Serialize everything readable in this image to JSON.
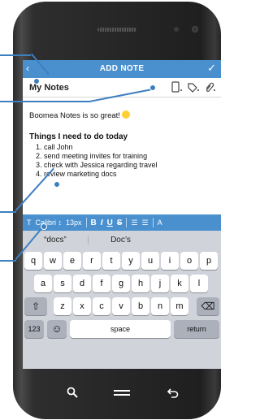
{
  "appbar": {
    "title": "ADD NOTE",
    "back_icon": "chevron-left-icon",
    "save_icon": "checkmark-icon"
  },
  "note": {
    "title": "My Notes",
    "intro": "Boomea Notes is so great!",
    "heading": "Things I need to do today",
    "items": [
      "call John",
      "send meeting invites for training",
      "check with Jessica regarding travel",
      "review marketing docs"
    ]
  },
  "format_bar": {
    "text_icon": "T",
    "font": "Calibri ↕",
    "size": "13px",
    "bold": "B",
    "italic": "I",
    "underline": "U",
    "strike": "S",
    "bullets_icon": "☰",
    "numbered_icon": "☰",
    "more": "A"
  },
  "keyboard": {
    "suggestions": [
      "“docs”",
      "Doc’s",
      ""
    ],
    "row1": [
      "q",
      "w",
      "e",
      "r",
      "t",
      "y",
      "u",
      "i",
      "o",
      "p"
    ],
    "row2": [
      "a",
      "s",
      "d",
      "f",
      "g",
      "h",
      "j",
      "k",
      "l"
    ],
    "row3": [
      "z",
      "x",
      "c",
      "v",
      "b",
      "n",
      "m"
    ],
    "shift_icon": "⇧",
    "delete_icon": "⌫",
    "numbers_key": "123",
    "emoji_icon": "☺",
    "space_key": "space",
    "return_key": "return"
  },
  "nav": {
    "search_icon": "●",
    "home_icon": "═",
    "back_icon": "↩"
  },
  "colors": {
    "accent": "#4a90cf",
    "callout": "#3d7fc0"
  }
}
